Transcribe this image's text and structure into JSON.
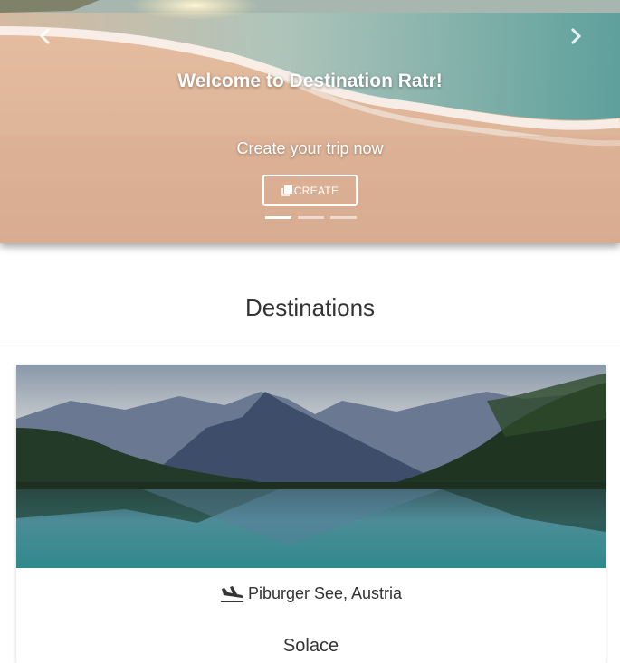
{
  "carousel": {
    "title": "Welcome to Destination Ratr!",
    "subtitle": "Create your trip now",
    "button_label": "CREATE",
    "indicators": [
      {
        "state": "active"
      },
      {
        "state": "inactive"
      },
      {
        "state": "inactive"
      }
    ],
    "prev_icon": "chevron-left-icon",
    "next_icon": "chevron-right-icon"
  },
  "section": {
    "title": "Destinations"
  },
  "cards": [
    {
      "location": "Piburger See, Austria",
      "name": "Solace",
      "icon": "plane-landing-icon"
    }
  ],
  "colors": {
    "text": "#333333",
    "divider": "#d7d7d7",
    "hero_text": "#ffffff"
  }
}
